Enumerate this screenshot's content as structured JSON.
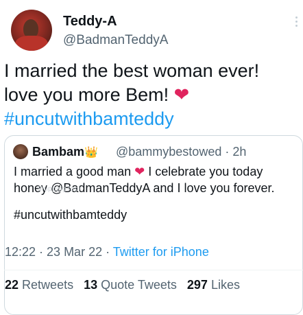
{
  "author": {
    "display_name": "Teddy-A",
    "handle": "@BadmanTeddyA"
  },
  "tweet": {
    "line1": "I married the best woman ever!",
    "line2": "love you more Bem!",
    "heart": "❤",
    "hashtag": "#uncutwithbamteddy"
  },
  "quote": {
    "name": "Bambam",
    "crown": "👑",
    "handle_time": "@bammybestowed · 2h",
    "text_before_heart": "I married a good man",
    "heart": "❤",
    "text_after_heart": "I celebrate you today honey @BadmanTeddyA and I love you forever.",
    "hashtag": "#uncutwithbamteddy"
  },
  "meta": {
    "time_date": "12:22 · 23 Mar 22 · ",
    "client": "Twitter for iPhone",
    "watermark": "ShippingTool"
  },
  "stats": {
    "retweets_count": "22",
    "retweets_label": "Retweets",
    "quotes_count": "13",
    "quotes_label": "Quote Tweets",
    "likes_count": "297",
    "likes_label": "Likes"
  },
  "colors": {
    "link": "#1d9bf0",
    "heart": "#e0245e",
    "secondary_text": "#536471"
  }
}
